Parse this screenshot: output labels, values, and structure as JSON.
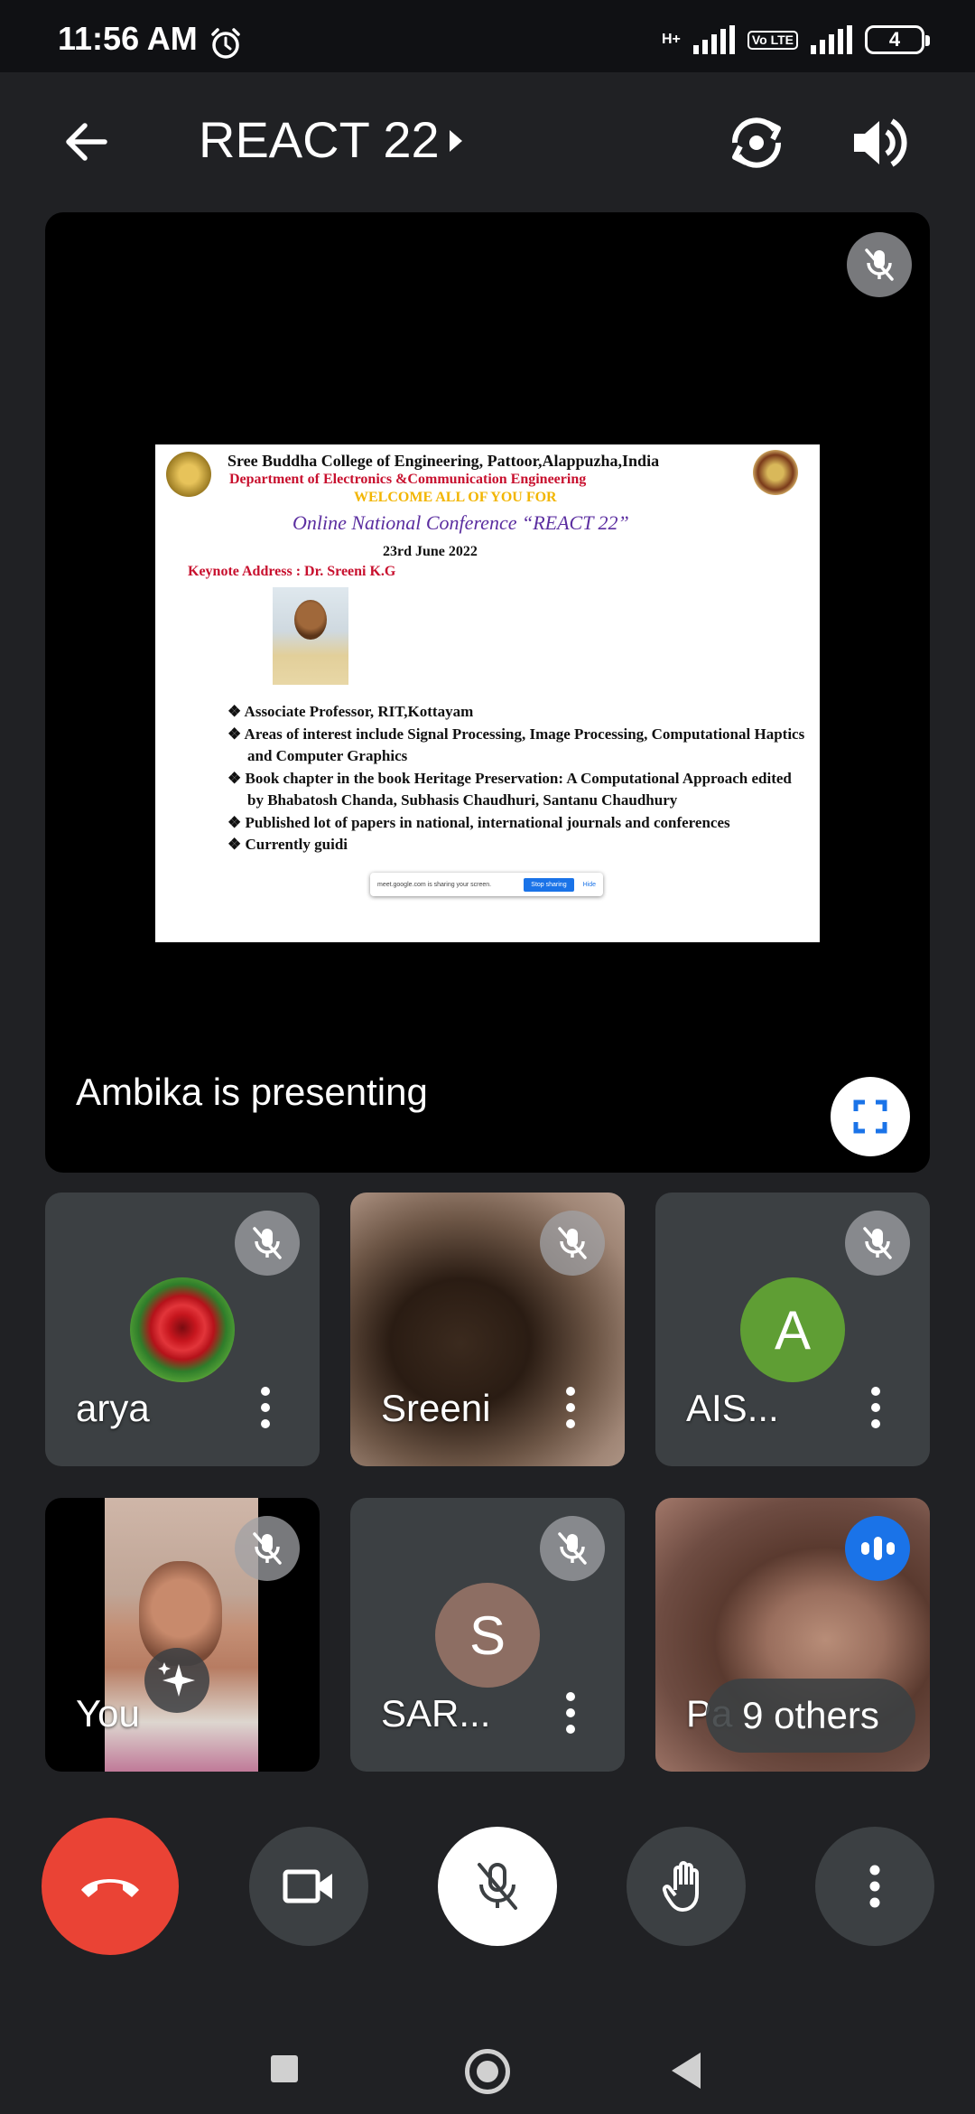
{
  "status_bar": {
    "time": "11:56 AM",
    "network_type": "H+",
    "volte_label": "Vo LTE",
    "battery_level": "4",
    "icons": [
      "alarm-icon",
      "signal-icon",
      "volte-icon",
      "battery-icon"
    ]
  },
  "header": {
    "title": "REACT 22",
    "icons": [
      "back-arrow-icon",
      "chevron-right-icon",
      "switch-camera-icon",
      "speaker-icon"
    ]
  },
  "presentation": {
    "presenter_label": "Ambika is presenting",
    "slide": {
      "line1": "Sree Buddha College of Engineering, Pattoor,Alappuzha,India",
      "line2": "Department of Electronics &Communication Engineering",
      "line3": "WELCOME ALL OF YOU FOR",
      "line4": "Online National Conference “REACT 22”",
      "line5": "23rd June 2022",
      "line6": "Keynote Address : Dr. Sreeni K.G",
      "bullets": [
        "❖ Associate Professor, RIT,Kottayam",
        "❖ Areas of interest include Signal Processing, Image Processing, Computational Haptics and Computer Graphics",
        "❖ Book chapter in the book Heritage Preservation: A Computational Approach edited by Bhabatosh Chanda, Subhasis Chaudhuri, Santanu Chaudhury",
        "❖ Published lot of papers in national, international journals and conferences",
        "❖ Currently guidi"
      ],
      "share_bar": {
        "text": "meet.google.com is sharing your screen.",
        "stop_label": "Stop sharing",
        "hide_label": "Hide"
      }
    }
  },
  "participants": [
    {
      "name": "arya",
      "avatar_type": "rose-image"
    },
    {
      "name": "Sreeni",
      "avatar_type": "video"
    },
    {
      "name": "AIS...",
      "avatar_letter": "A",
      "avatar_color": "#5f9e34"
    },
    {
      "name": "You",
      "avatar_type": "video"
    },
    {
      "name": "SAR...",
      "avatar_letter": "S",
      "avatar_color": "#8d6e63"
    },
    {
      "name": "Pa",
      "avatar_type": "video",
      "others_label": "9 others"
    }
  ],
  "controls": {
    "icons": [
      "end-call-icon",
      "camera-icon",
      "mic-off-icon",
      "raise-hand-icon",
      "more-options-icon"
    ],
    "end_color": "#ea4335"
  },
  "colors": {
    "background": "#202124",
    "tile": "#3c4043",
    "accent_blue": "#1a73e8"
  }
}
